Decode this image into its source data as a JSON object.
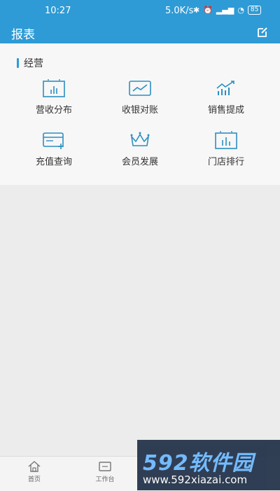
{
  "status_bar": {
    "time": "10:27",
    "network_speed": "5.0K/s",
    "battery": "85"
  },
  "app_bar": {
    "title": "报表"
  },
  "section": {
    "title": "经营"
  },
  "colors": {
    "primary": "#2e9bd6",
    "icon": "#2b8fc2"
  },
  "grid_items": [
    {
      "label": "营收分布",
      "icon": "bar-chart-icon"
    },
    {
      "label": "收银对账",
      "icon": "trend-card-icon"
    },
    {
      "label": "销售提成",
      "icon": "growth-icon"
    },
    {
      "label": "充值查询",
      "icon": "card-plus-icon"
    },
    {
      "label": "会员发展",
      "icon": "crown-icon"
    },
    {
      "label": "门店排行",
      "icon": "ranking-chart-icon"
    }
  ],
  "tabs": [
    {
      "label": "首页",
      "icon": "home-icon"
    },
    {
      "label": "工作台",
      "icon": "workbench-icon"
    }
  ],
  "watermark": {
    "logo": "592软件园",
    "url": "www.592xiazai.com"
  }
}
